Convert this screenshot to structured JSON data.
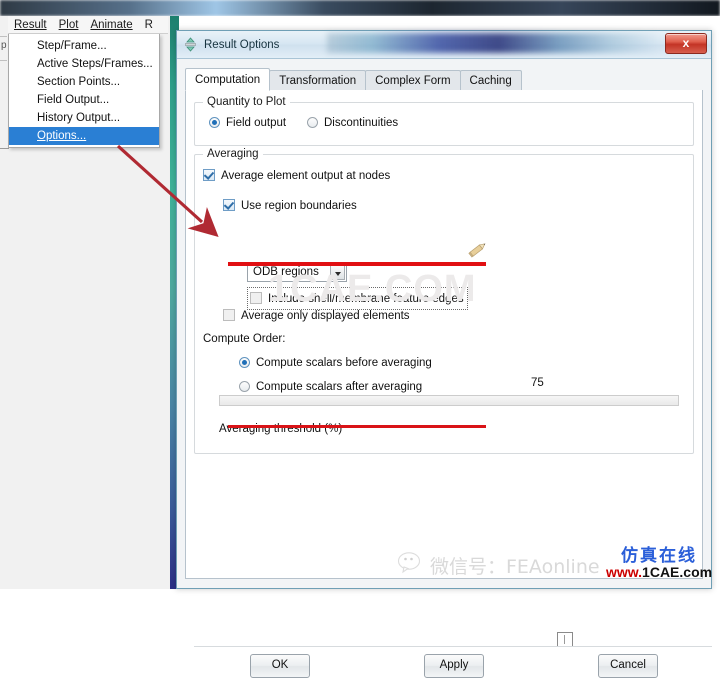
{
  "desktop": {
    "edge_letter": "p"
  },
  "menubar": {
    "items": [
      {
        "label": "Result",
        "mnemonic": "R"
      },
      {
        "label": "Plot",
        "mnemonic": "P"
      },
      {
        "label": "Animate",
        "mnemonic": "A"
      },
      {
        "label": "R",
        "mnemonic": "R"
      }
    ]
  },
  "dropdown": {
    "items": [
      {
        "label": "Step/Frame...",
        "selected": false
      },
      {
        "label": "Active Steps/Frames...",
        "selected": false
      },
      {
        "label": "Section Points...",
        "selected": false
      },
      {
        "label": "Field Output...",
        "selected": false
      },
      {
        "label": "History Output...",
        "selected": false
      },
      {
        "label": "Options...",
        "selected": true
      }
    ]
  },
  "dialog": {
    "title": "Result Options",
    "close_label": "x",
    "tabs": [
      {
        "label": "Computation",
        "active": true
      },
      {
        "label": "Transformation",
        "active": false
      },
      {
        "label": "Complex Form",
        "active": false
      },
      {
        "label": "Caching",
        "active": false
      }
    ],
    "quantity_group": {
      "title": "Quantity to Plot",
      "options": [
        {
          "label": "Field output",
          "checked": true
        },
        {
          "label": "Discontinuities",
          "checked": false
        }
      ]
    },
    "averaging_group": {
      "title": "Averaging",
      "average_element_output": {
        "label": "Average element output at nodes",
        "checked": true
      },
      "use_region_boundaries": {
        "label": "Use region boundaries",
        "checked": true
      },
      "region_combo": {
        "value": "ODB regions"
      },
      "include_shell_edges": {
        "label": "Include shell/membrane feature edges",
        "checked": false
      },
      "average_only_displayed": {
        "label": "Average only displayed elements",
        "checked": false
      },
      "compute_order_label": "Compute Order:",
      "compute_order_options": [
        {
          "label": "Compute scalars before averaging",
          "checked": true
        },
        {
          "label": "Compute scalars after averaging",
          "checked": false
        }
      ],
      "slider": {
        "value": "75",
        "label": "Averaging threshold (%)",
        "min": 0,
        "max": 100
      }
    },
    "buttons": [
      {
        "label": "OK"
      },
      {
        "label": "Apply"
      },
      {
        "label": "Cancel"
      }
    ]
  },
  "watermarks": {
    "center": "1CAE.COM",
    "wechat": "微信号：FEAonline",
    "brand_cn": "仿真在线",
    "brand_url_prefix": "www.",
    "brand_url_rest": "1CAE.com"
  },
  "colors": {
    "accent_blue": "#2a7fd4",
    "annotation_red": "#e10f12",
    "close_red": "#c33325",
    "brand_blue": "#2b5fd9",
    "brand_red": "#cc0000"
  }
}
